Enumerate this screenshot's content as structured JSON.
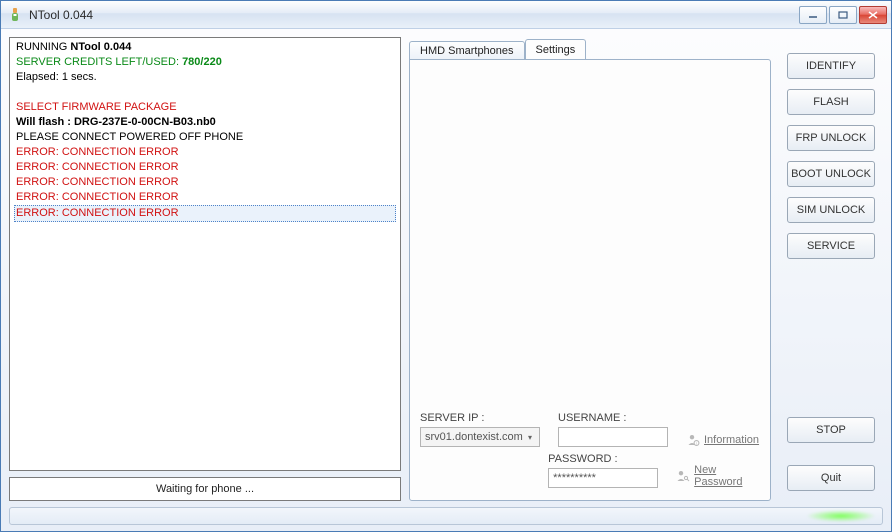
{
  "window": {
    "title": "NTool 0.044"
  },
  "log": {
    "running_prefix": "RUNNING ",
    "running_app": "NTool 0.044",
    "credits_label": "SERVER CREDITS LEFT/USED: ",
    "credits_value": "780/220",
    "elapsed": "Elapsed: 1 secs.",
    "select_firmware": "SELECT FIRMWARE PACKAGE",
    "will_flash": "Will flash : DRG-237E-0-00CN-B03.nb0",
    "connect_msg": "PLEASE CONNECT POWERED OFF PHONE",
    "error_1": "ERROR: CONNECTION ERROR",
    "error_2": "ERROR: CONNECTION ERROR",
    "error_3": "ERROR: CONNECTION ERROR",
    "error_4": "ERROR: CONNECTION ERROR",
    "error_5": "ERROR: CONNECTION ERROR"
  },
  "status": "Waiting for phone ...",
  "tabs": {
    "hmd": "HMD Smartphones",
    "settings": "Settings"
  },
  "settings": {
    "server_ip_label": "SERVER IP :",
    "server_ip_value": "srv01.dontexist.com",
    "username_label": "USERNAME :",
    "username_value": "",
    "password_label": "PASSWORD :",
    "password_value": "**********",
    "info_link": "Information",
    "newpass_link": "New Password"
  },
  "actions": {
    "identify": "IDENTIFY",
    "flash": "FLASH",
    "frp_unlock": "FRP UNLOCK",
    "boot_unlock": "BOOT UNLOCK",
    "sim_unlock": "SIM UNLOCK",
    "service": "SERVICE",
    "stop": "STOP",
    "quit": "Quit"
  }
}
